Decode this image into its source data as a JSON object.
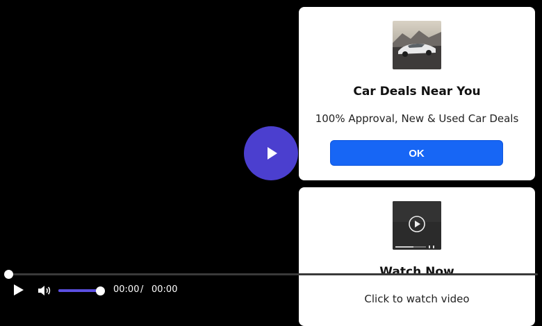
{
  "player": {
    "current_time": "00:00",
    "separator": "/",
    "duration": "00:00",
    "progress": 0,
    "volume": 1.0,
    "accent_color": "#4b3fcf"
  },
  "ads": [
    {
      "thumbnail_icon": "car-photo",
      "title": "Car Deals Near You",
      "description": "100% Approval, New & Used Car Deals",
      "button_label": "OK",
      "button_color": "#1766f5"
    },
    {
      "thumbnail_icon": "video-thumbnail-play-icon",
      "title": "Watch Now",
      "description": "Click to watch video"
    }
  ]
}
